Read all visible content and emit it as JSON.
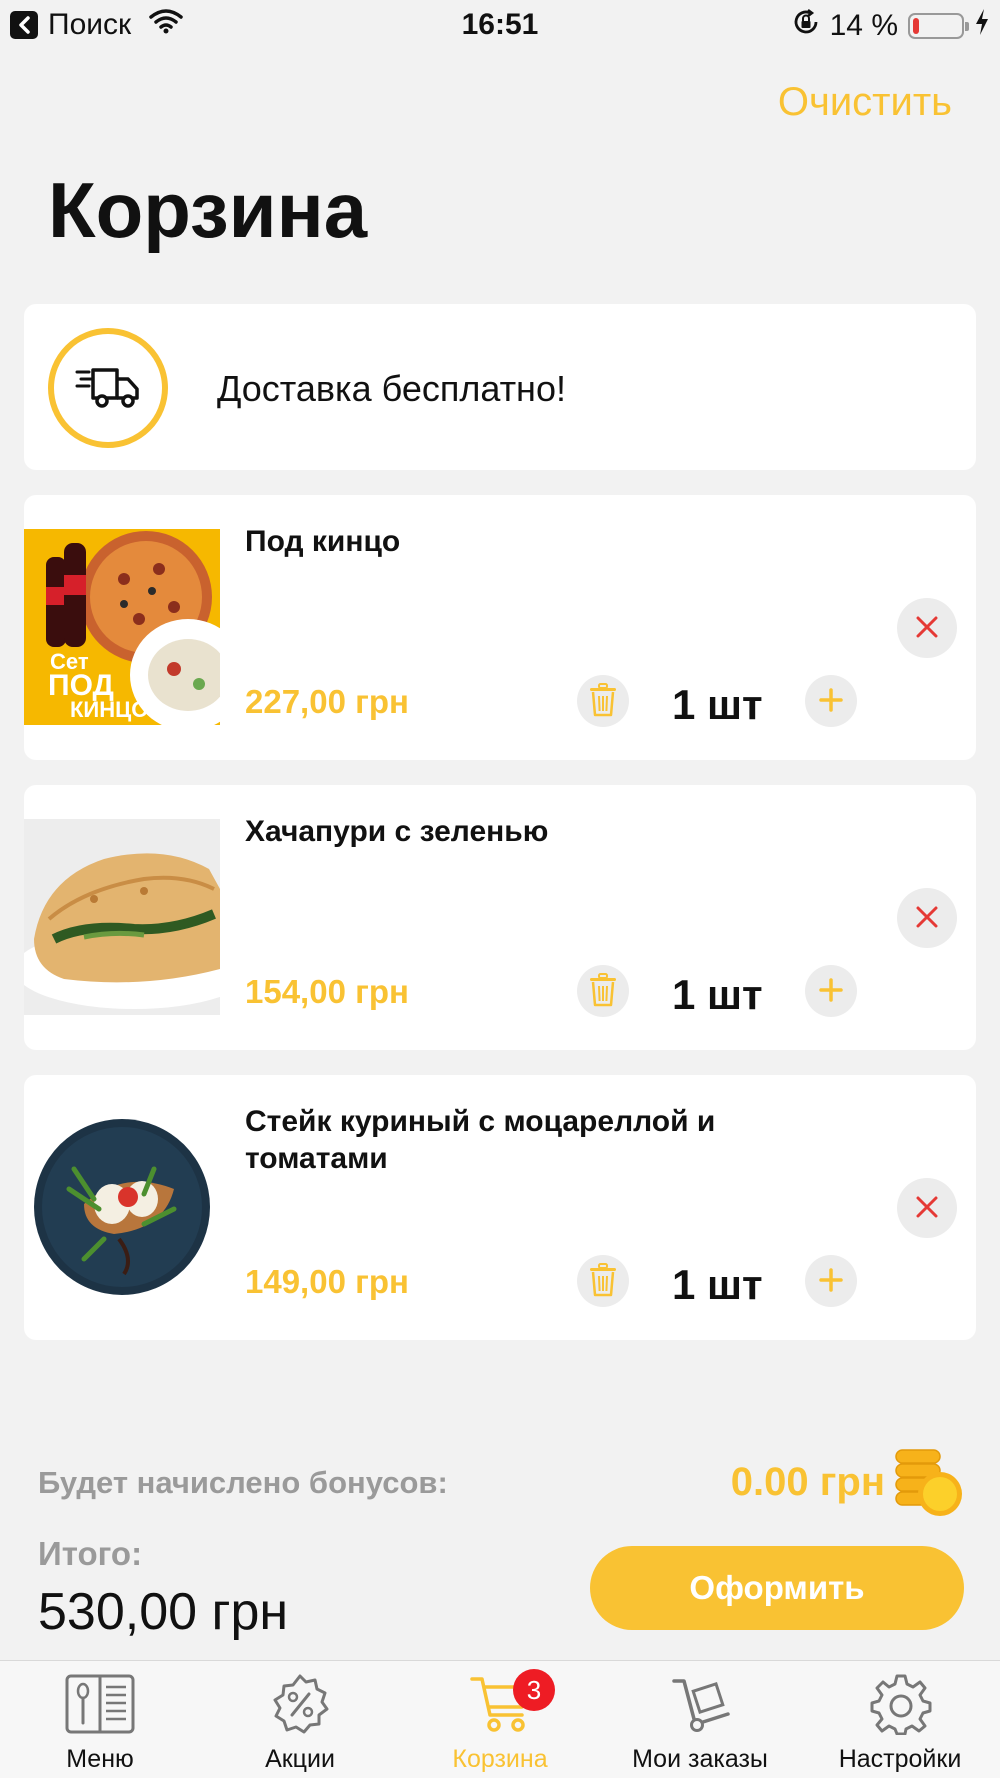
{
  "status_bar": {
    "back_label": "Поиск",
    "time": "16:51",
    "battery": "14 %",
    "battery_level": 0.14
  },
  "header": {
    "clear_label": "Очистить",
    "title": "Корзина"
  },
  "delivery": {
    "text": "Доставка бесплатно!",
    "icon": "truck-icon"
  },
  "items": [
    {
      "name": "Под кинцо",
      "price": "227,00 грн",
      "qty": "1 шт",
      "image": {
        "kind": "set-promo",
        "text_line1": "Сет",
        "text_line2": "ПОД",
        "text_line3": "КИНЦО"
      }
    },
    {
      "name": "Хачапури с зеленью",
      "price": "154,00 грн",
      "qty": "1 шт",
      "image": {
        "kind": "khachapuri"
      }
    },
    {
      "name": "Стейк куриный с моцареллой и томатами",
      "price": "149,00 грн",
      "qty": "1 шт",
      "image": {
        "kind": "steak"
      }
    }
  ],
  "summary": {
    "bonus_label": "Будет начислено бонусов:",
    "bonus_value": "0.00 грн",
    "total_label": "Итого:",
    "total_value": "530,00 грн",
    "checkout_label": "Оформить"
  },
  "tabs": [
    {
      "label": "Меню",
      "icon": "menu-book-icon",
      "active": false
    },
    {
      "label": "Акции",
      "icon": "discount-badge-icon",
      "active": false
    },
    {
      "label": "Корзина",
      "icon": "cart-icon",
      "active": true,
      "badge": "3"
    },
    {
      "label": "Мои заказы",
      "icon": "hand-truck-icon",
      "active": false
    },
    {
      "label": "Настройки",
      "icon": "settings-gear-icon",
      "active": false
    }
  ],
  "colors": {
    "accent": "#f9c233",
    "background": "#f2f2f2",
    "remove": "#e53935",
    "badge": "#ee1c24"
  }
}
